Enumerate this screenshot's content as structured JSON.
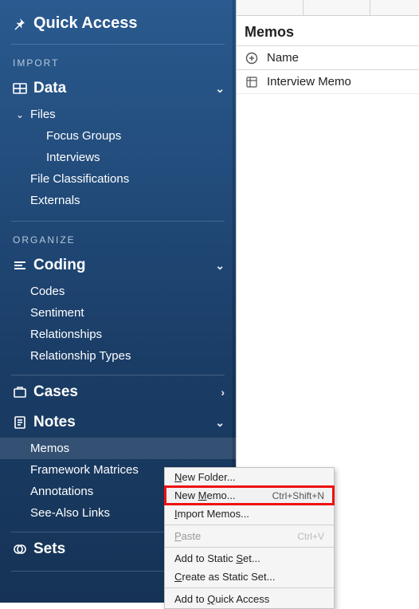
{
  "sidebar": {
    "quick_access": "Quick Access",
    "import_label": "IMPORT",
    "organize_label": "ORGANIZE",
    "data": {
      "label": "Data",
      "files": "Files",
      "focus_groups": "Focus Groups",
      "interviews": "Interviews",
      "file_classifications": "File Classifications",
      "externals": "Externals"
    },
    "coding": {
      "label": "Coding",
      "codes": "Codes",
      "sentiment": "Sentiment",
      "relationships": "Relationships",
      "relationship_types": "Relationship Types"
    },
    "cases": {
      "label": "Cases"
    },
    "notes": {
      "label": "Notes",
      "memos": "Memos",
      "framework_matrices": "Framework Matrices",
      "annotations": "Annotations",
      "see_also_links": "See-Also Links"
    },
    "sets": {
      "label": "Sets"
    }
  },
  "main": {
    "panel_title": "Memos",
    "column_name": "Name",
    "rows": {
      "0": {
        "name": "Interview Memo"
      }
    }
  },
  "context_menu": {
    "new_folder": "New Folder...",
    "new_memo": "New Memo...",
    "new_memo_accel": "Ctrl+Shift+N",
    "import_memos": "Import Memos...",
    "paste": "Paste",
    "paste_accel": "Ctrl+V",
    "add_to_static_set": "Add to Static Set...",
    "create_as_static_set": "Create as Static Set...",
    "add_to_quick_access": "Add to Quick Access"
  }
}
